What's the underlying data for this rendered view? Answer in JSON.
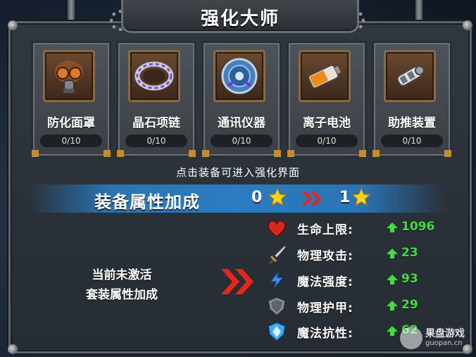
{
  "title": "强化大师",
  "equipment": [
    {
      "name": "防化面罩",
      "progress": "0/10",
      "icon": "gas-mask-icon"
    },
    {
      "name": "晶石项链",
      "progress": "0/10",
      "icon": "crystal-ring-icon"
    },
    {
      "name": "通讯仪器",
      "progress": "0/10",
      "icon": "radar-device-icon"
    },
    {
      "name": "离子电池",
      "progress": "0/10",
      "icon": "battery-icon"
    },
    {
      "name": "助推装置",
      "progress": "0/10",
      "icon": "booster-arm-icon"
    }
  ],
  "hint": "点击装备可进入强化界面",
  "bonus": {
    "label": "装备属性加成",
    "from_stars": "0",
    "to_stars": "1"
  },
  "set_status": {
    "line1": "当前未激活",
    "line2": "套装属性加成"
  },
  "stats": [
    {
      "label": "生命上限:",
      "value": "1096",
      "icon": "heart-icon",
      "color": "#d7281f"
    },
    {
      "label": "物理攻击:",
      "value": "23",
      "icon": "sword-icon",
      "color": "#c9b48a"
    },
    {
      "label": "魔法强度:",
      "value": "93",
      "icon": "lightning-icon",
      "color": "#3a8ef0"
    },
    {
      "label": "物理护甲:",
      "value": "29",
      "icon": "shield-icon",
      "color": "#8a8f96"
    },
    {
      "label": "魔法抗性:",
      "value": "62",
      "icon": "magic-shield-icon",
      "color": "#3fa9f5"
    }
  ],
  "watermark": {
    "name": "果盘游戏",
    "url": "guopan.cn"
  },
  "colors": {
    "accent_green": "#3fe03a",
    "banner_blue": "#2b7cc0",
    "chevron_red": "#e8241c",
    "star_gold": "#ffd21f"
  }
}
